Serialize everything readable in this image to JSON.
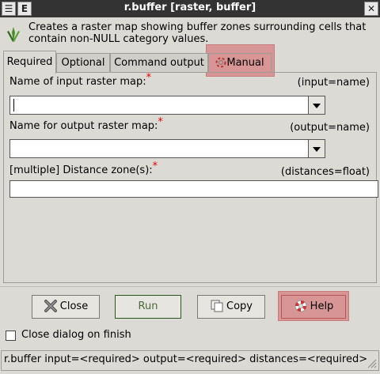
{
  "window": {
    "title": "r.buffer [raster, buffer]",
    "left_btn_1": "☰",
    "left_btn_2": "E",
    "close_btn": "✕"
  },
  "description": "Creates a raster map showing buffer zones surrounding cells that contain non-NULL category values.",
  "tabs": [
    {
      "label": "Required"
    },
    {
      "label": "Optional"
    },
    {
      "label": "Command output"
    },
    {
      "label": "Manual"
    }
  ],
  "fields": {
    "input": {
      "label": "Name of input raster map:",
      "required_mark": "*",
      "param": "(input=name)",
      "value": ""
    },
    "output": {
      "label": "Name for output raster map:",
      "required_mark": "*",
      "param": "(output=name)",
      "value": ""
    },
    "distances": {
      "label": "[multiple] Distance zone(s):",
      "required_mark": "*",
      "param": "(distances=float)",
      "value": ""
    }
  },
  "buttons": {
    "close": "Close",
    "run": "Run",
    "copy": "Copy",
    "help": "Help"
  },
  "close_on_finish": {
    "label": "Close dialog on finish",
    "checked": false
  },
  "statusbar": "r.buffer input=<required> output=<required> distances=<required>",
  "colors": {
    "highlight": "#d88a8a",
    "required": "#e00000",
    "titlebar": "#333333"
  }
}
